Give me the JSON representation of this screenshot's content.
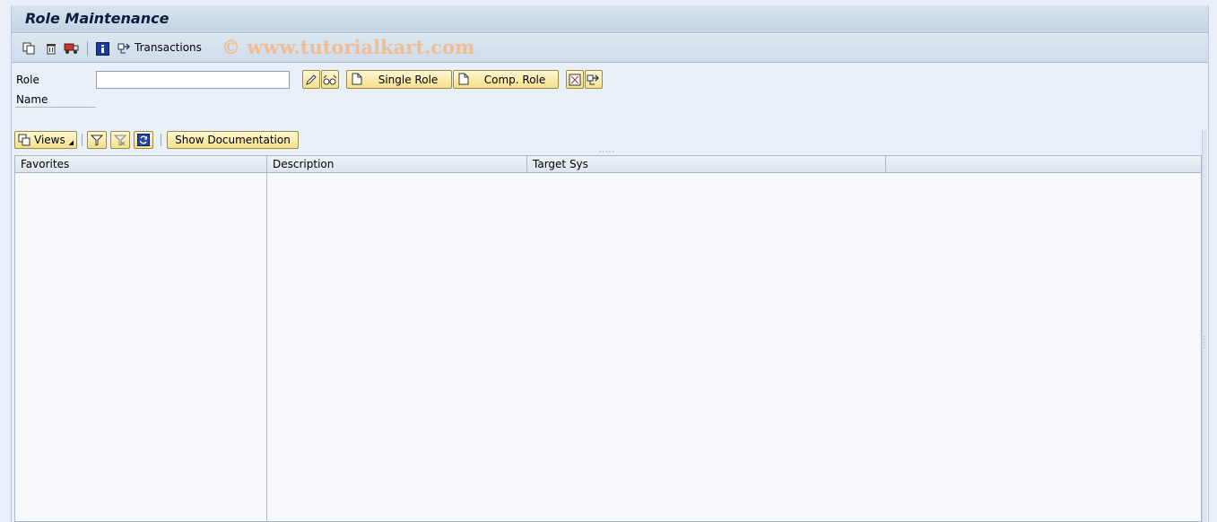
{
  "window": {
    "title": "Role Maintenance"
  },
  "toolbar": {
    "transactions_label": "Transactions",
    "watermark": "© www.tutorialkart.com",
    "icons": [
      "copy-icon",
      "delete-icon",
      "transport-icon",
      "info-icon",
      "transactions-icon"
    ]
  },
  "form": {
    "role_label": "Role",
    "role_value": "",
    "name_label": "Name",
    "single_role_label": "Single Role",
    "comp_role_label": "Comp. Role"
  },
  "panel": {
    "views_label": "Views",
    "show_doc_label": "Show Documentation"
  },
  "table": {
    "columns": [
      "Favorites",
      "Description",
      "Target Sys",
      ""
    ]
  },
  "colors": {
    "button_yellow": "#f5e08a",
    "background": "#eaf0f7",
    "title_text": "#0b1f3a",
    "watermark": "#f2b98a"
  }
}
